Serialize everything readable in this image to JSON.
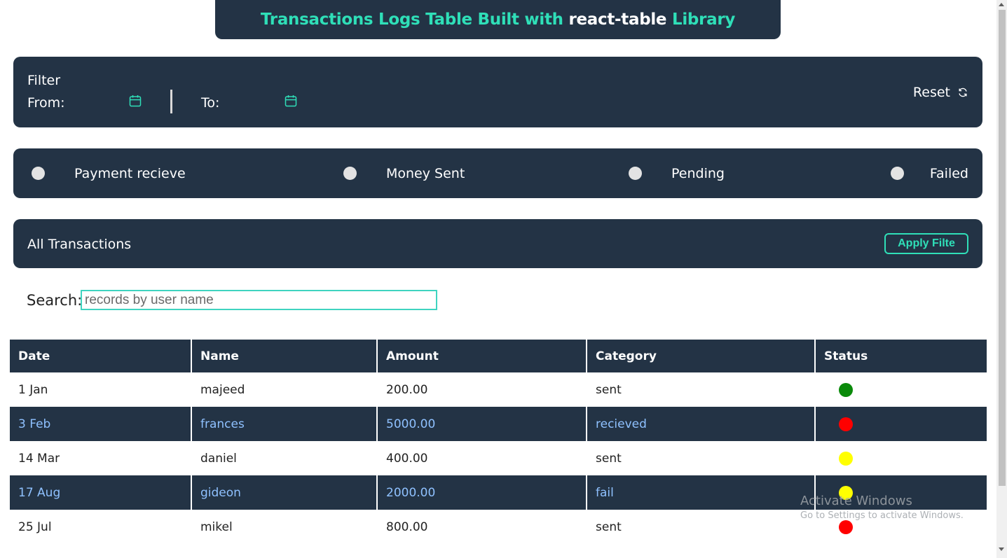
{
  "title": {
    "part1": "Transactions Logs Table Built with",
    "part2": "react-table",
    "part3": "Library"
  },
  "filter": {
    "label": "Filter",
    "from_label": "From:",
    "to_label": "To:",
    "reset_label": "Reset",
    "calendar_icon": "calendar-icon",
    "reset_icon": "refresh-icon"
  },
  "status_filters": [
    {
      "label": "Payment recieve"
    },
    {
      "label": "Money Sent"
    },
    {
      "label": "Pending"
    },
    {
      "label": "Failed"
    }
  ],
  "transactions_bar": {
    "label": "All Transactions",
    "apply_label": "Apply Filte"
  },
  "search": {
    "label": "Search:",
    "placeholder": "records by user name"
  },
  "table": {
    "headers": [
      "Date",
      "Name",
      "Amount",
      "Category",
      "Status"
    ],
    "rows": [
      {
        "date": "1 Jan",
        "name": "majeed",
        "amount": "200.00",
        "category": "sent",
        "status_color": "#0a8a0a"
      },
      {
        "date": "3 Feb",
        "name": "frances",
        "amount": "5000.00",
        "category": "recieved",
        "status_color": "#ff0000"
      },
      {
        "date": "14 Mar",
        "name": "daniel",
        "amount": "400.00",
        "category": "sent",
        "status_color": "#ffff00"
      },
      {
        "date": "17 Aug",
        "name": "gideon",
        "amount": "2000.00",
        "category": "fail",
        "status_color": "#ffff00"
      },
      {
        "date": "25 Jul",
        "name": "mikel",
        "amount": "800.00",
        "category": "sent",
        "status_color": "#ff0000"
      }
    ]
  },
  "watermark": {
    "title": "Activate Windows",
    "subtitle": "Go to Settings to activate Windows."
  },
  "colors": {
    "panel_bg": "#233345",
    "accent": "#2fdfb8",
    "alt_row_text": "#8fc1ff"
  }
}
